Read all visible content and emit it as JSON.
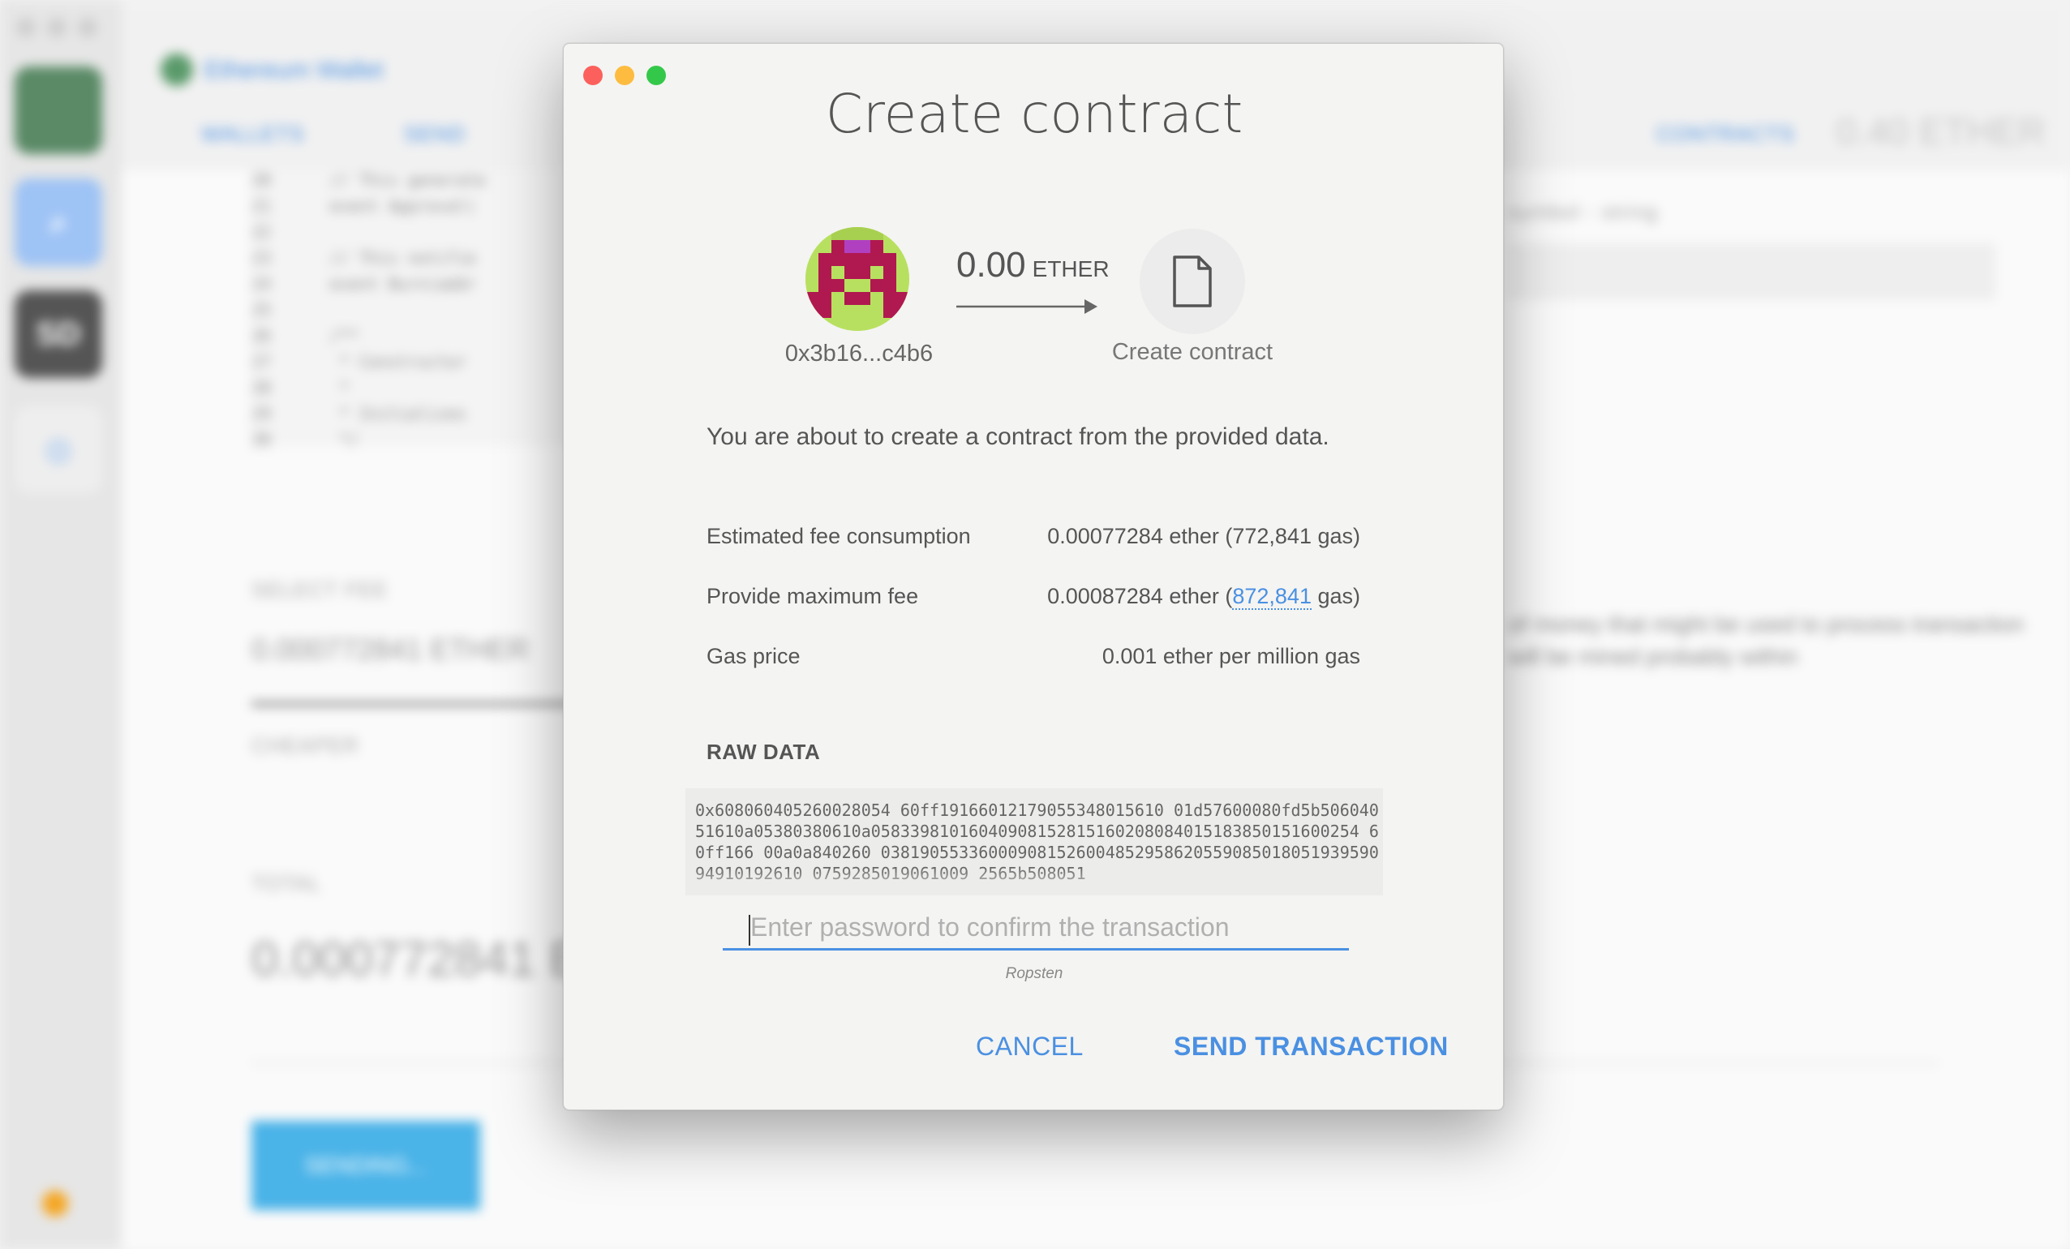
{
  "background": {
    "app_title": "Ethereum Wallet",
    "tabs": [
      "WALLETS",
      "SEND",
      "CONTRACTS"
    ],
    "balance": "0.40 ETHER",
    "code_lines": [
      {
        "num": "20",
        "text": "// This generate"
      },
      {
        "num": "21",
        "text": "event Approval("
      },
      {
        "num": "22",
        "text": ""
      },
      {
        "num": "23",
        "text": "// This notifie"
      },
      {
        "num": "24",
        "text": "event Burn(addr"
      },
      {
        "num": "25",
        "text": ""
      },
      {
        "num": "26",
        "text": "/**"
      },
      {
        "num": "27",
        "text": " * Constructor"
      },
      {
        "num": "28",
        "text": " *"
      },
      {
        "num": "29",
        "text": " * Initializes"
      },
      {
        "num": "30",
        "text": " */"
      }
    ],
    "select_fee_label": "SELECT FEE",
    "fee_value": "0.000772841 ETHER",
    "cheaper_label": "CHEAPER",
    "total_label": "TOTAL",
    "total_value": "0.000772841 E",
    "sending_button": "SENDING...",
    "right_symbol_label": "symbol - string",
    "right_text": "of money that might be used to process transaction will be mined probably within"
  },
  "modal": {
    "title": "Create contract",
    "from_address": "0x3b16...c4b6",
    "amount": "0.00",
    "amount_unit": "ETHER",
    "to_label": "Create contract",
    "to_icon": "document-icon",
    "intro": "You are about to create a contract from the provided data.",
    "rows": {
      "estimated_label": "Estimated fee consumption",
      "estimated_value": "0.00077284 ether (772,841 gas)",
      "max_fee_label": "Provide maximum fee",
      "max_fee_prefix": "0.00087284 ether (",
      "max_fee_gas": "872,841",
      "max_fee_suffix": " gas)",
      "gas_price_label": "Gas price",
      "gas_price_value": "0.001 ether per million gas"
    },
    "raw_data_title": "RAW DATA",
    "raw_data": "0x608060405260028054 60ff19166012179055348015610 01d57600080fd5b50604051610a05380380610a05833981016040908152815160208084015183850151600254 60ff166 00a0a840260 03819055336000908152600485295862055908501805193959094910192610 0759285019061009 2565b508051",
    "password_placeholder": "Enter password to confirm the transaction",
    "network": "Ropsten",
    "cancel_label": "CANCEL",
    "send_label": "SEND TRANSACTION"
  },
  "colors": {
    "accent": "#4a90e2",
    "close": "#fc605c",
    "minimize": "#fdbc40",
    "maximize": "#34c84a"
  }
}
